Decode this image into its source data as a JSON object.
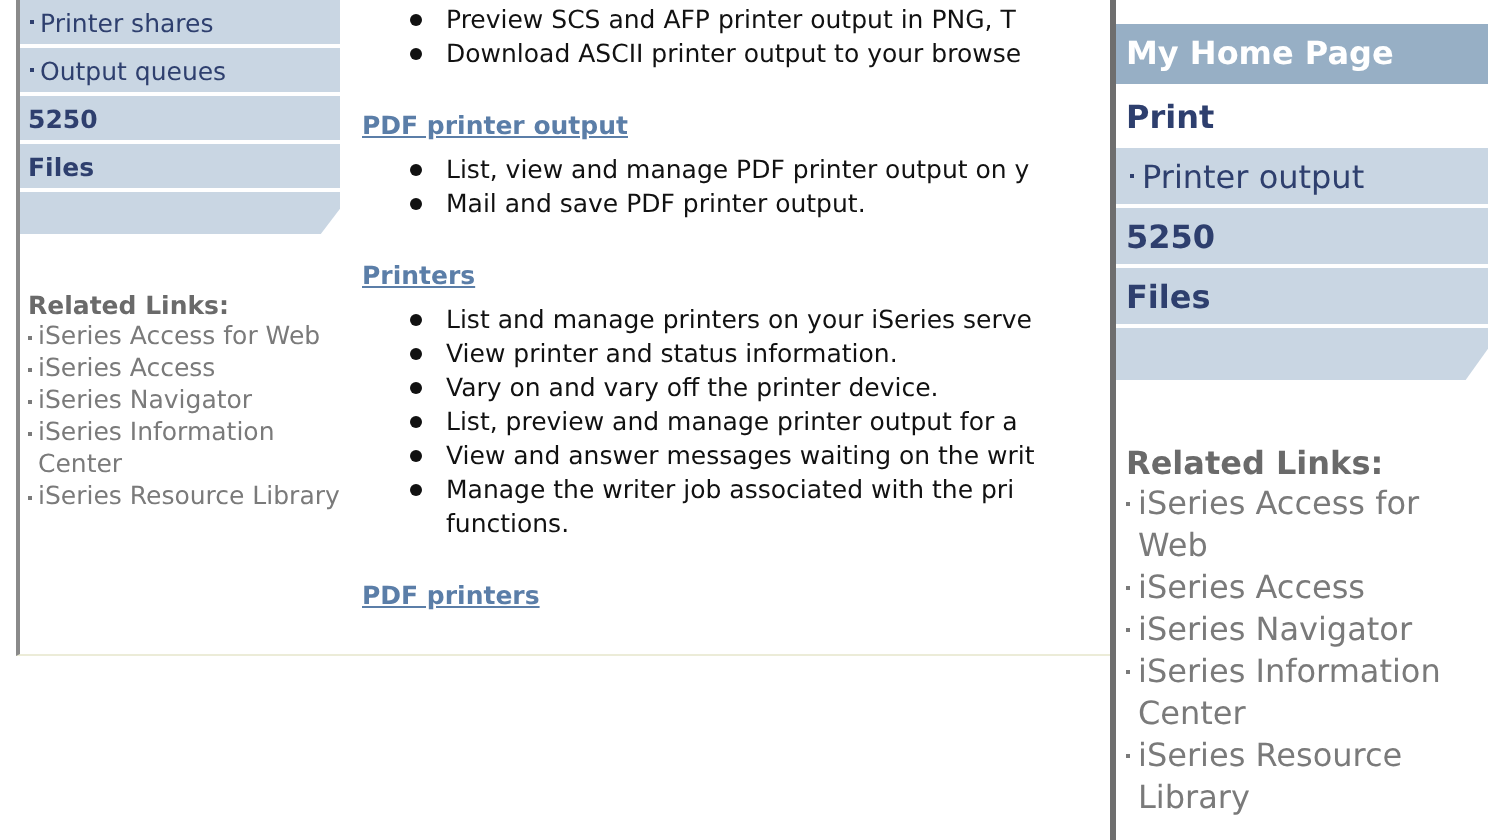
{
  "left_sidebar": {
    "items": [
      {
        "kind": "subitem",
        "label": "Printer shares"
      },
      {
        "kind": "subitem",
        "label": "Output queues"
      },
      {
        "kind": "section",
        "label": "5250"
      },
      {
        "kind": "section",
        "label": "Files"
      }
    ],
    "related_links": {
      "title": "Related Links:",
      "links": [
        {
          "label": "iSeries Access for Web"
        },
        {
          "label": "iSeries Access"
        },
        {
          "label": "iSeries Navigator"
        },
        {
          "label": "iSeries Information Center"
        },
        {
          "label": "iSeries Resource Library"
        }
      ]
    }
  },
  "content": {
    "sections": [
      {
        "bullets": [
          {
            "lines": [
              "Preview SCS and AFP printer output in PNG, T"
            ]
          },
          {
            "lines": [
              "Download ASCII printer output to your browse"
            ]
          }
        ]
      },
      {
        "title": "PDF printer output",
        "bullets": [
          {
            "lines": [
              "List, view and manage PDF printer output on y"
            ]
          },
          {
            "lines": [
              "Mail and save PDF printer output."
            ]
          }
        ]
      },
      {
        "title": "Printers",
        "bullets": [
          {
            "lines": [
              "List and manage printers on your iSeries serve"
            ]
          },
          {
            "lines": [
              "View printer and status information."
            ]
          },
          {
            "lines": [
              "Vary on and vary off the printer device."
            ]
          },
          {
            "lines": [
              "List, preview and manage printer output for a"
            ]
          },
          {
            "lines": [
              "View and answer messages waiting on the writ"
            ]
          },
          {
            "lines": [
              "Manage the writer job associated with the pri",
              "functions."
            ]
          }
        ]
      },
      {
        "title": "PDF printers"
      }
    ]
  },
  "overlay": {
    "header": "My Home Page",
    "items": [
      {
        "kind": "current",
        "label": "Print"
      },
      {
        "kind": "subitem",
        "label": "Printer output"
      },
      {
        "kind": "section",
        "label": "5250"
      },
      {
        "kind": "section",
        "label": "Files"
      }
    ],
    "related_links": {
      "title": "Related Links:",
      "links": [
        {
          "label": "iSeries Access for Web"
        },
        {
          "label": "iSeries Access"
        },
        {
          "label": "iSeries Navigator"
        },
        {
          "label": "iSeries Information Center"
        },
        {
          "label": "iSeries Resource Library"
        }
      ]
    }
  }
}
